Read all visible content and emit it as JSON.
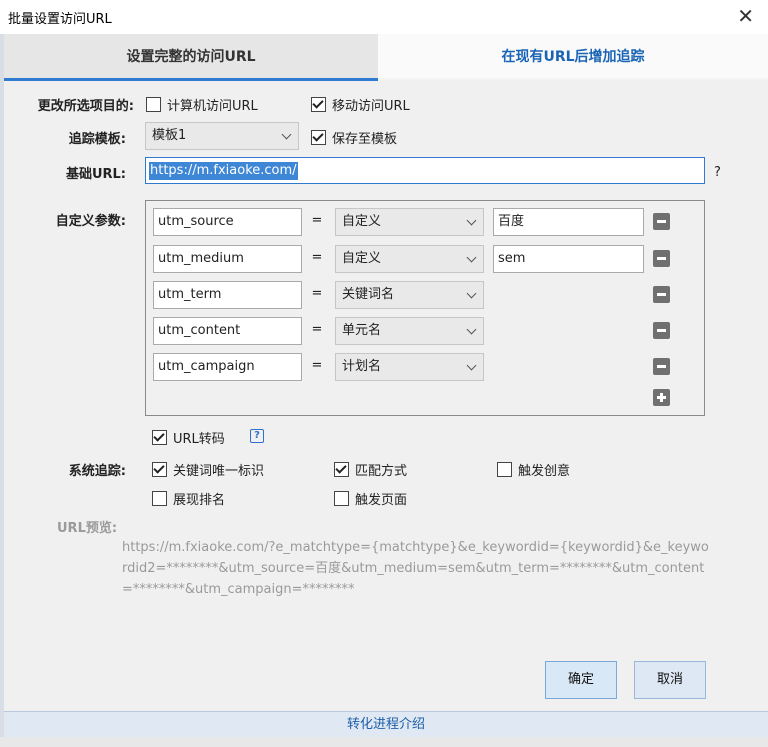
{
  "window": {
    "title": "批量设置访问URL"
  },
  "tabs": [
    {
      "label": "设置完整的访问URL",
      "active": true
    },
    {
      "label": "在现有URL后增加追踪",
      "active": false
    }
  ],
  "modify_target": {
    "label": "更改所选项目的:",
    "pc": {
      "label": "计算机访问URL",
      "checked": false
    },
    "mobile": {
      "label": "移动访问URL",
      "checked": true
    }
  },
  "template": {
    "label": "追踪模板:",
    "value": "模板1",
    "save": {
      "label": "保存至模板",
      "checked": true
    }
  },
  "base_url": {
    "label": "基础URL:",
    "value": "https://m.fxiaoke.com/",
    "help": "?"
  },
  "custom_params": {
    "label": "自定义参数:",
    "equals": "=",
    "rows": [
      {
        "name": "utm_source",
        "type": "自定义",
        "value": "百度"
      },
      {
        "name": "utm_medium",
        "type": "自定义",
        "value": "sem"
      },
      {
        "name": "utm_term",
        "type": "关键词名",
        "value": ""
      },
      {
        "name": "utm_content",
        "type": "单元名",
        "value": ""
      },
      {
        "name": "utm_campaign",
        "type": "计划名",
        "value": ""
      }
    ]
  },
  "url_encode": {
    "label": "URL转码",
    "checked": true,
    "help": "?"
  },
  "system_tracking": {
    "label": "系统追踪:",
    "keyword_id": {
      "label": "关键词唯一标识",
      "checked": true
    },
    "match_type": {
      "label": "匹配方式",
      "checked": true
    },
    "trigger_creative": {
      "label": "触发创意",
      "checked": false
    },
    "show_rank": {
      "label": "展现排名",
      "checked": false
    },
    "trigger_page": {
      "label": "触发页面",
      "checked": false
    }
  },
  "preview": {
    "label": "URL预览:",
    "text": "https://m.fxiaoke.com/?e_matchtype={matchtype}&e_keywordid={keywordid}&e_keywordid2=********&utm_source=百度&utm_medium=sem&utm_term=********&utm_content=********&utm_campaign=********"
  },
  "buttons": {
    "ok": "确定",
    "cancel": "取消"
  },
  "footer": {
    "link": "转化进程介绍"
  },
  "colors": {
    "accent": "#2f7bd1",
    "link": "#1a64b6"
  }
}
